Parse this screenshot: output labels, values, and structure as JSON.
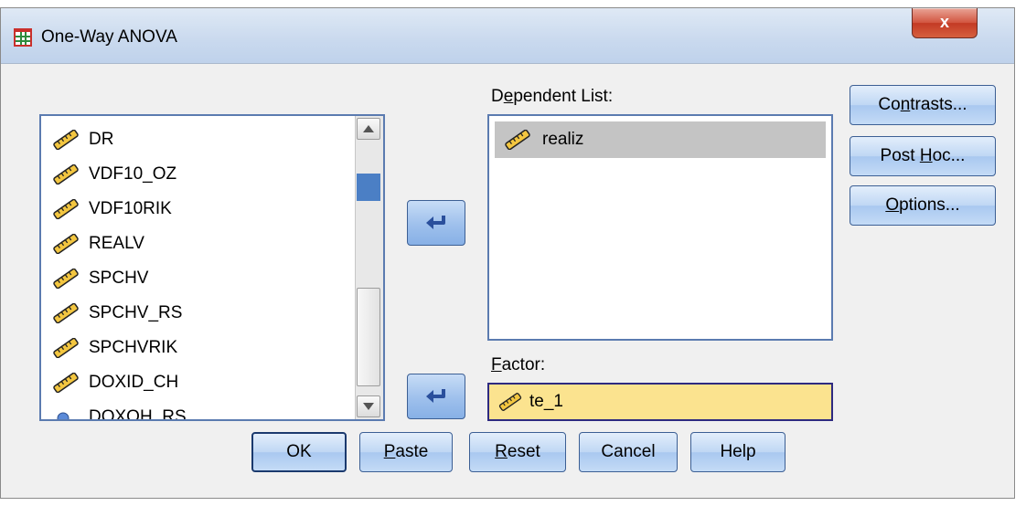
{
  "window": {
    "title": "One-Way ANOVA",
    "close_label": "x"
  },
  "variables": {
    "items": [
      {
        "label": "DR",
        "icon": "ruler-icon"
      },
      {
        "label": "VDF10_OZ",
        "icon": "ruler-icon"
      },
      {
        "label": "VDF10RIK",
        "icon": "ruler-icon"
      },
      {
        "label": "REALV",
        "icon": "ruler-icon"
      },
      {
        "label": "SPCHV",
        "icon": "ruler-icon"
      },
      {
        "label": "SPCHV_RS",
        "icon": "ruler-icon"
      },
      {
        "label": "SPCHVRIK",
        "icon": "ruler-icon"
      },
      {
        "label": "DOXID_CH",
        "icon": "ruler-icon"
      },
      {
        "label": "DOXOH_RS",
        "icon": "nominal-icon"
      }
    ]
  },
  "dependent": {
    "label_prefix": "D",
    "label_underlined": "e",
    "label_rest": "pendent List:",
    "items": [
      "realiz"
    ]
  },
  "factor": {
    "label_underlined": "F",
    "label_rest": "actor:",
    "value": "te_1"
  },
  "side_buttons": {
    "contrasts_a": "Co",
    "contrasts_u": "n",
    "contrasts_b": "trasts...",
    "posthoc_a": "Post ",
    "posthoc_u": "H",
    "posthoc_b": "oc...",
    "options_u": "O",
    "options_b": "ptions..."
  },
  "bottom_buttons": {
    "ok": "OK",
    "paste_u": "P",
    "paste_b": "aste",
    "reset_u": "R",
    "reset_b": "eset",
    "cancel": "Cancel",
    "help": "Help"
  },
  "colors": {
    "accent": "#4b7fc5",
    "factor_bg": "#fbe38f",
    "selection": "#c4c4c4"
  }
}
